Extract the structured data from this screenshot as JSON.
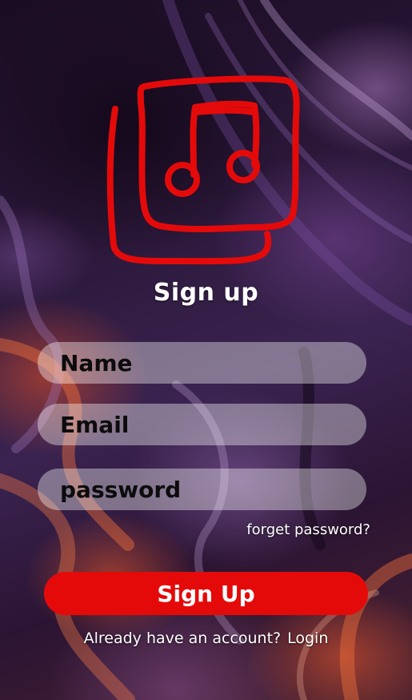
{
  "header": {
    "title": "Sign up"
  },
  "logo": {
    "icon": "music-note-icon",
    "color": "#e50a0a"
  },
  "form": {
    "name_placeholder": "Name",
    "email_placeholder": "Email",
    "password_placeholder": "password",
    "forgot_label": "forget password?",
    "submit_label": "Sign Up"
  },
  "footer": {
    "prompt": "Already have an account?",
    "login_label": "Login"
  },
  "colors": {
    "accent": "#e50a0a",
    "field_bg": "rgba(255,255,255,0.38)",
    "text": "#ffffff"
  }
}
